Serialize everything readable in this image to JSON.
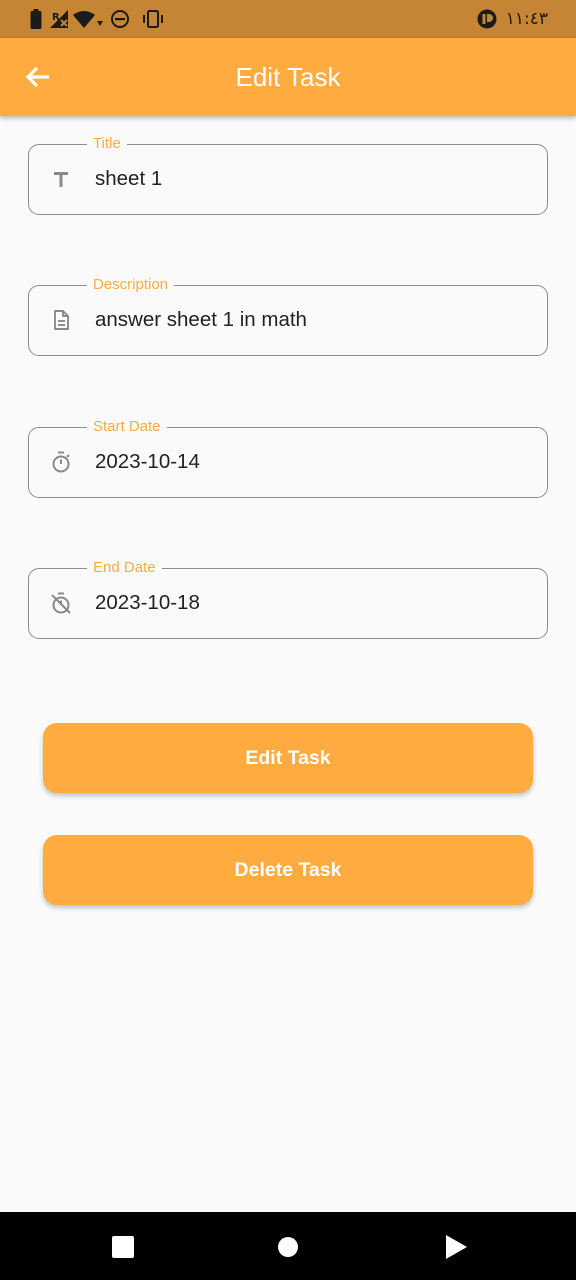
{
  "status_bar": {
    "time": "١١:٤٣"
  },
  "app_bar": {
    "title": "Edit Task"
  },
  "form": {
    "title": {
      "label": "Title",
      "value": "sheet 1"
    },
    "description": {
      "label": "Description",
      "value": "answer sheet 1 in math"
    },
    "start_date": {
      "label": "Start Date",
      "value": "2023-10-14"
    },
    "end_date": {
      "label": "End Date",
      "value": "2023-10-18"
    }
  },
  "actions": {
    "edit_label": "Edit Task",
    "delete_label": "Delete Task"
  },
  "colors": {
    "accent": "#ffab40",
    "status_bar": "#c68535",
    "background": "#fafafa",
    "field_border": "#8d8d8d"
  },
  "icons": {
    "title": "text-fields-icon",
    "description": "description-icon",
    "start_date": "timer-icon",
    "end_date": "timer-off-icon",
    "back": "arrow-back-icon"
  }
}
